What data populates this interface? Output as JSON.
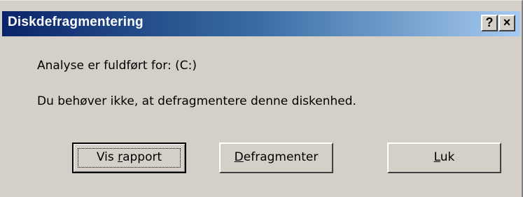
{
  "window": {
    "title": "Diskdefragmentering",
    "help_button": "?",
    "close_button": "×"
  },
  "message": {
    "line1": "Analyse er fuldført for: (C:)",
    "line2": "Du behøver ikke, at defragmentere denne diskenhed."
  },
  "buttons": {
    "rapport": {
      "pre": "Vis ",
      "mnemonic": "r",
      "post": "apport"
    },
    "defrag": {
      "pre": "",
      "mnemonic": "D",
      "post": "efragmenter"
    },
    "luk": {
      "pre": "",
      "mnemonic": "L",
      "post": "uk"
    }
  }
}
